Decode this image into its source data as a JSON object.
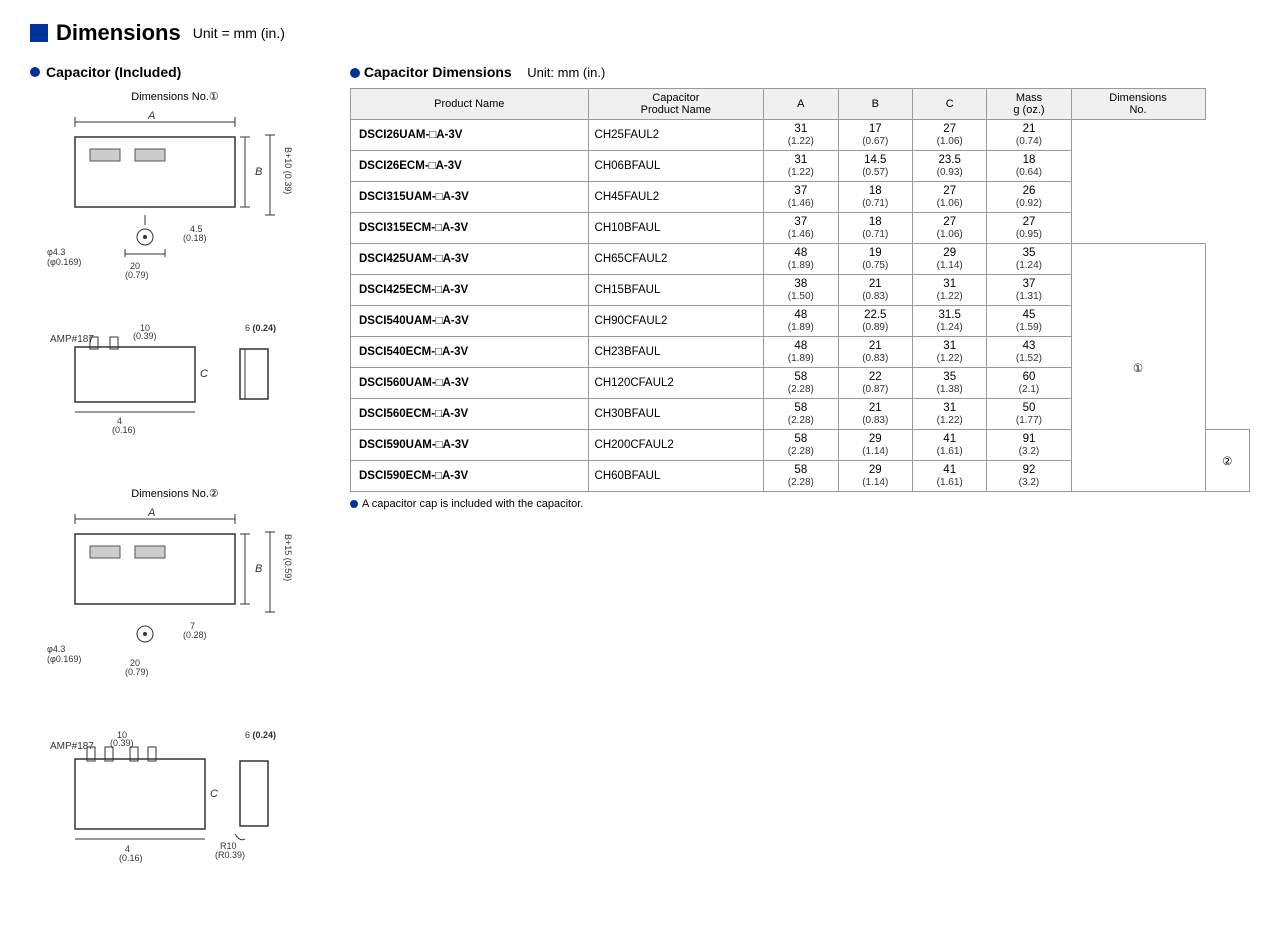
{
  "header": {
    "title": "Dimensions",
    "unit": "Unit = mm (in.)"
  },
  "left": {
    "section_label": "Capacitor (Included)",
    "dim1_label": "Dimensions No.①",
    "dim2_label": "Dimensions No.②"
  },
  "right": {
    "section_label": "Capacitor Dimensions",
    "unit": "Unit: mm (in.)",
    "table": {
      "headers": [
        "Product Name",
        "Capacitor\nProduct Name",
        "A",
        "B",
        "C",
        "Mass\ng (oz.)",
        "Dimensions\nNo."
      ],
      "rows": [
        {
          "product": "DSCI26UAM-□A-3V",
          "cap": "CH25FAUL2",
          "a": "31\n(1.22)",
          "b": "17\n(0.67)",
          "c": "27\n(1.06)",
          "mass": "21\n(0.74)",
          "dim_no": ""
        },
        {
          "product": "DSCI26ECM-□A-3V",
          "cap": "CH06BFAUL",
          "a": "31\n(1.22)",
          "b": "14.5\n(0.57)",
          "c": "23.5\n(0.93)",
          "mass": "18\n(0.64)",
          "dim_no": ""
        },
        {
          "product": "DSCI315UAM-□A-3V",
          "cap": "CH45FAUL2",
          "a": "37\n(1.46)",
          "b": "18\n(0.71)",
          "c": "27\n(1.06)",
          "mass": "26\n(0.92)",
          "dim_no": ""
        },
        {
          "product": "DSCI315ECM-□A-3V",
          "cap": "CH10BFAUL",
          "a": "37\n(1.46)",
          "b": "18\n(0.71)",
          "c": "27\n(1.06)",
          "mass": "27\n(0.95)",
          "dim_no": ""
        },
        {
          "product": "DSCI425UAM-□A-3V",
          "cap": "CH65CFAUL2",
          "a": "48\n(1.89)",
          "b": "19\n(0.75)",
          "c": "29\n(1.14)",
          "mass": "35\n(1.24)",
          "dim_no": "①"
        },
        {
          "product": "DSCI425ECM-□A-3V",
          "cap": "CH15BFAUL",
          "a": "38\n(1.50)",
          "b": "21\n(0.83)",
          "c": "31\n(1.22)",
          "mass": "37\n(1.31)",
          "dim_no": ""
        },
        {
          "product": "DSCI540UAM-□A-3V",
          "cap": "CH90CFAUL2",
          "a": "48\n(1.89)",
          "b": "22.5\n(0.89)",
          "c": "31.5\n(1.24)",
          "mass": "45\n(1.59)",
          "dim_no": ""
        },
        {
          "product": "DSCI540ECM-□A-3V",
          "cap": "CH23BFAUL",
          "a": "48\n(1.89)",
          "b": "21\n(0.83)",
          "c": "31\n(1.22)",
          "mass": "43\n(1.52)",
          "dim_no": ""
        },
        {
          "product": "DSCI560UAM-□A-3V",
          "cap": "CH120CFAUL2",
          "a": "58\n(2.28)",
          "b": "22\n(0.87)",
          "c": "35\n(1.38)",
          "mass": "60\n(2.1)",
          "dim_no": ""
        },
        {
          "product": "DSCI560ECM-□A-3V",
          "cap": "CH30BFAUL",
          "a": "58\n(2.28)",
          "b": "21\n(0.83)",
          "c": "31\n(1.22)",
          "mass": "50\n(1.77)",
          "dim_no": ""
        },
        {
          "product": "DSCI590UAM-□A-3V",
          "cap": "CH200CFAUL2",
          "a": "58\n(2.28)",
          "b": "29\n(1.14)",
          "c": "41\n(1.61)",
          "mass": "91\n(3.2)",
          "dim_no": "②"
        },
        {
          "product": "DSCI590ECM-□A-3V",
          "cap": "CH60BFAUL",
          "a": "58\n(2.28)",
          "b": "29\n(1.14)",
          "c": "41\n(1.61)",
          "mass": "92\n(3.2)",
          "dim_no": ""
        }
      ]
    },
    "note": "A capacitor cap is included with the capacitor."
  }
}
